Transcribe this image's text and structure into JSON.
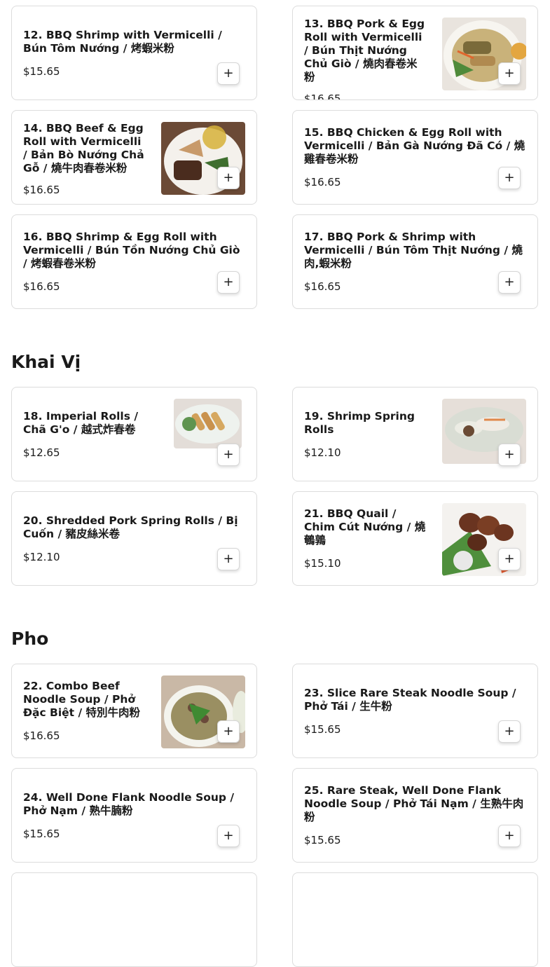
{
  "sections": {
    "khai_vi": "Khai Vị",
    "pho": "Pho"
  },
  "add_label": "+",
  "items": {
    "i12": {
      "name": "12. BBQ Shrimp with Vermicelli / Bún Tôm Nướng / 烤蝦米粉",
      "price": "$15.65"
    },
    "i13": {
      "name": "13. BBQ Pork & Egg Roll with Vermicelli / Bún Thịt Nướng Chủ Giò / 燒肉春卷米粉",
      "price": "$16.65"
    },
    "i14": {
      "name": "14. BBQ Beef & Egg Roll with Vermicelli / Bản Bò Nướng Chả Gỗ / 燒牛肉春卷米粉",
      "price": "$16.65"
    },
    "i15": {
      "name": "15. BBQ Chicken & Egg Roll with Vermicelli / Bản Gà Nướng Đã Có / 燒雞春卷米粉",
      "price": "$16.65"
    },
    "i16": {
      "name": "16. BBQ Shrimp & Egg Roll with Vermicelli / Bún Tồn Nướng Chủ Giò / 烤蝦春卷米粉",
      "price": "$16.65"
    },
    "i17": {
      "name": "17. BBQ Pork & Shrimp with Vermicelli / Bún Tôm Thịt Nướng / 燒肉,蝦米粉",
      "price": "$16.65"
    },
    "i18": {
      "name": "18. Imperial Rolls / Chã G'o / 越式炸春卷",
      "price": "$12.65"
    },
    "i19": {
      "name": "19. Shrimp Spring Rolls",
      "price": "$12.10"
    },
    "i20": {
      "name": "20. Shredded Pork Spring Rolls / Bị Cuốn / 豬皮絲米卷",
      "price": "$12.10"
    },
    "i21": {
      "name": "21. BBQ Quail / Chim Cút Nướng / 燒鵪鶉",
      "price": "$15.10"
    },
    "i22": {
      "name": "22. Combo Beef Noodle Soup / Phở Đặc Biệt / 特別牛肉粉",
      "price": "$16.65"
    },
    "i23": {
      "name": "23. Slice Rare Steak Noodle Soup / Phở Tái / 生牛粉",
      "price": "$15.65"
    },
    "i24": {
      "name": "24. Well Done Flank Noodle Soup / Phở Nạm / 熟牛腩粉",
      "price": "$15.65"
    },
    "i25": {
      "name": "25. Rare Steak, Well Done Flank Noodle Soup / Phở Tái Nạm / 生熟牛肉粉",
      "price": "$15.65"
    }
  }
}
